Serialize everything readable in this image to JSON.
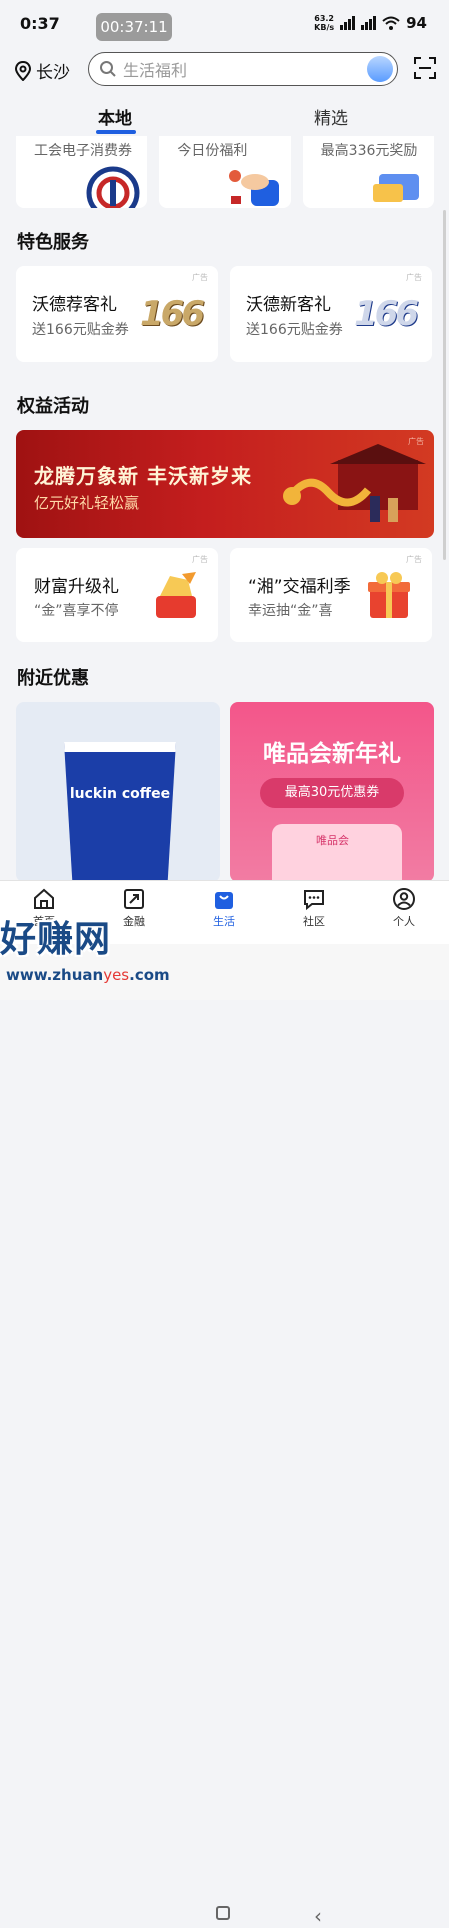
{
  "status": {
    "time": "0:37",
    "timer": "00:37:11",
    "net_speed": "63.2",
    "net_unit": "KB/s",
    "battery": "94"
  },
  "header": {
    "city": "长沙",
    "search_placeholder": "生活福利"
  },
  "tabs": [
    {
      "label": "本地",
      "active": true
    },
    {
      "label": "精选",
      "active": false
    }
  ],
  "top_cards": [
    {
      "label": "工会电子消费券"
    },
    {
      "label": "今日份福利"
    },
    {
      "label": "最高336元奖励"
    }
  ],
  "special": {
    "title": "特色服务",
    "cards": [
      {
        "title": "沃德荐客礼",
        "subtitle": "送166元贴金券",
        "ad": "广告",
        "figure": "166"
      },
      {
        "title": "沃德新客礼",
        "subtitle": "送166元贴金券",
        "ad": "广告",
        "figure": "166"
      }
    ]
  },
  "rights": {
    "title": "权益活动",
    "banner": {
      "headline": "龙腾万象新 丰沃新岁来",
      "sub": "亿元好礼轻松赢",
      "ad": "广告"
    },
    "cards": [
      {
        "title": "财富升级礼",
        "subtitle": "“金”喜享不停",
        "ad": "广告"
      },
      {
        "title": "“湘”交福利季",
        "subtitle": "幸运抽“金”喜",
        "ad": "广告"
      }
    ]
  },
  "nearby": {
    "title": "附近优惠",
    "left": {
      "brand": "luckin coffee"
    },
    "right": {
      "title": "唯品会新年礼",
      "coupon": "最高30元优惠券",
      "box": "唯品会"
    }
  },
  "nav": [
    {
      "label": "首页",
      "icon": "home-icon",
      "active": false
    },
    {
      "label": "金融",
      "icon": "finance-icon",
      "active": false
    },
    {
      "label": "生活",
      "icon": "shopping-bag-icon",
      "active": true
    },
    {
      "label": "社区",
      "icon": "chat-icon",
      "active": false
    },
    {
      "label": "个人",
      "icon": "person-icon",
      "active": false
    }
  ],
  "watermark": {
    "text": "好赚网",
    "url_prefix": "www.zhuan",
    "url_accent": "yes",
    "url_suffix": ".com"
  },
  "colors": {
    "accent": "#1f5fe0",
    "banner_red": "#c41e1e"
  }
}
